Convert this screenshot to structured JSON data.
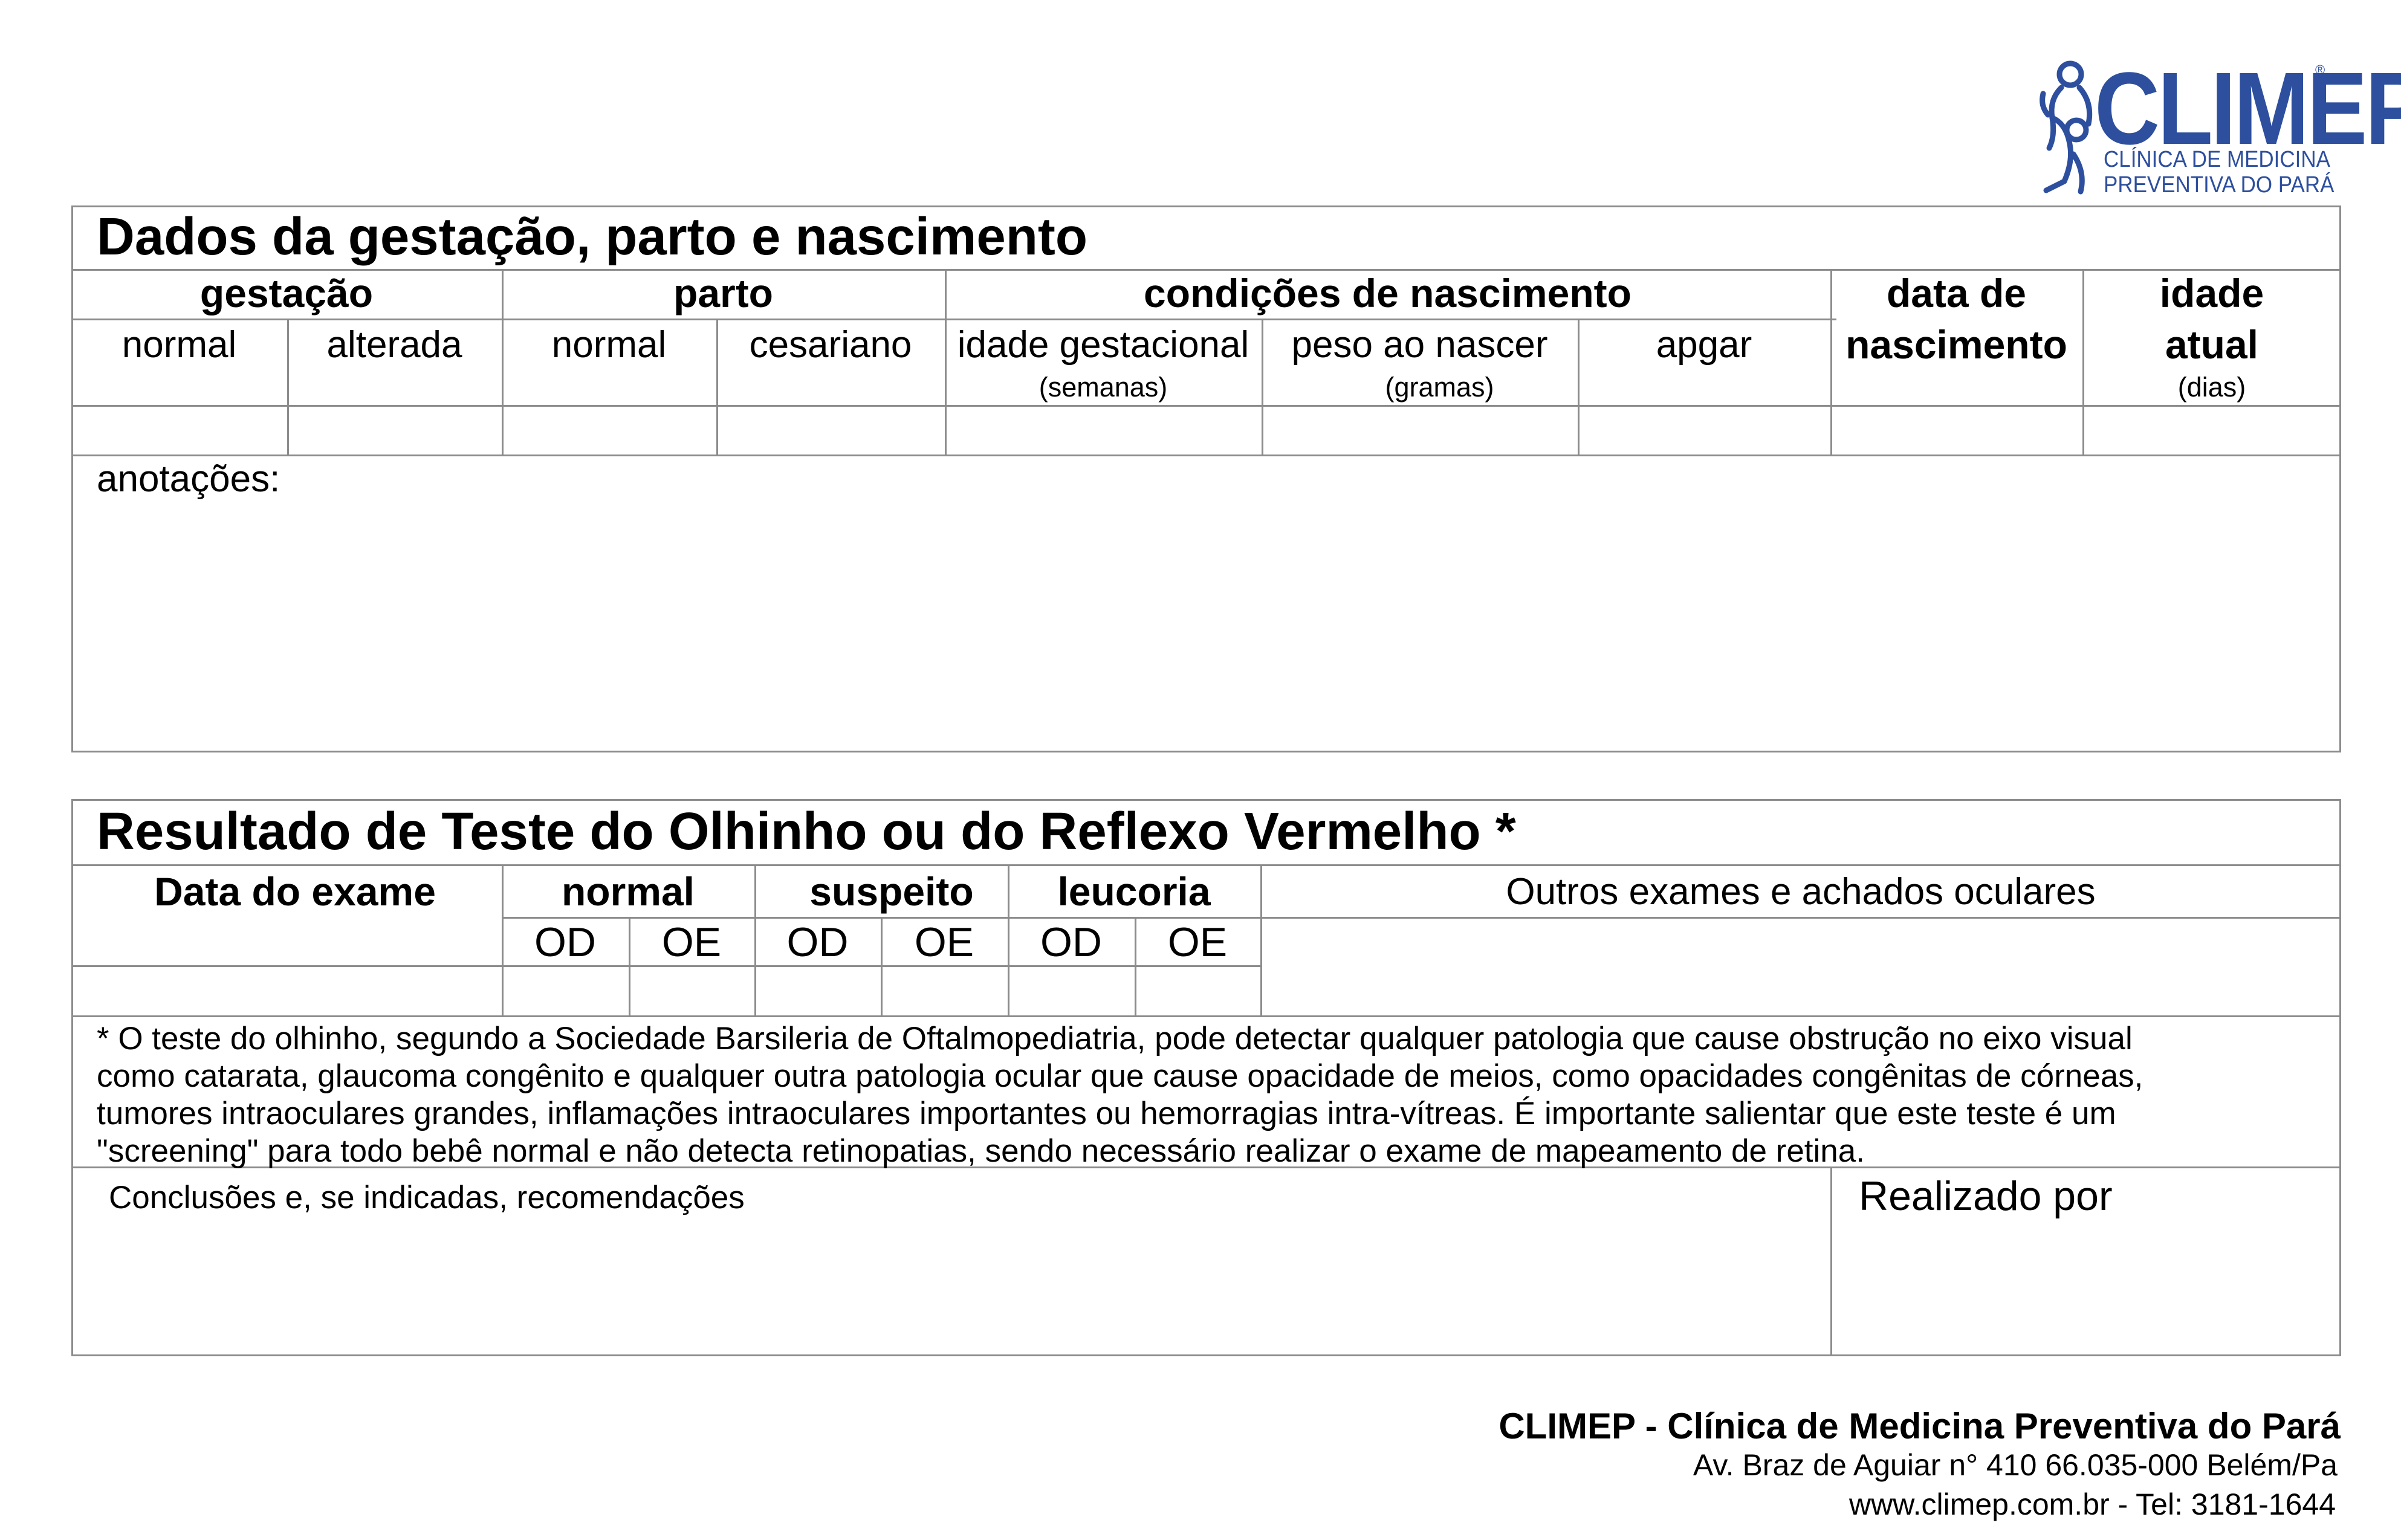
{
  "logo": {
    "brand": "CLIMEP",
    "line1": "CLÍNICA DE MEDICINA",
    "line2": "PREVENTIVA DO PARÁ",
    "color": "#2d4f9e"
  },
  "section1": {
    "title": "Dados da gestação, parto e nascimento",
    "groups": {
      "gestacao": "gestação",
      "parto": "parto",
      "condicoes": "condições de nascimento",
      "data_nasc_1": "data de",
      "data_nasc_2": "nascimento",
      "idade_1": "idade",
      "idade_2": "atual",
      "idade_unit": "(dias)"
    },
    "subs": {
      "gest_normal": "normal",
      "gest_alterada": "alterada",
      "parto_normal": "normal",
      "parto_cesariano": "cesariano",
      "idade_gestacional": "idade gestacional",
      "idade_gestacional_unit": "(semanas)",
      "peso": "peso ao nascer",
      "peso_unit": "(gramas)",
      "apgar": "apgar"
    },
    "anotacoes": "anotações:"
  },
  "section2": {
    "title": "Resultado de Teste do Olhinho ou do Reflexo Vermelho *",
    "data_exame": "Data do exame",
    "normal": "normal",
    "suspeito": "suspeito",
    "leucoria": "leucoria",
    "od": "OD",
    "oe": "OE",
    "outros": "Outros exames e achados oculares",
    "footnote": [
      "* O teste do olhinho, segundo a Sociedade Barsileria de Oftalmopediatria, pode detectar qualquer patologia que cause obstrução no eixo visual",
      "como catarata, glaucoma congênito e qualquer outra patologia ocular que cause opacidade de meios,  como opacidades congênitas de córneas,",
      "tumores intraoculares grandes, inflamações intraoculares importantes ou hemorragias intra-vítreas. É importante salientar que este teste é um",
      "\"screening\" para todo bebê  normal e não detecta retinopatias, sendo necessário realizar o exame de mapeamento de retina."
    ],
    "conclusoes": "Conclusões e, se indicadas, recomendações",
    "realizado": "Realizado por"
  },
  "footer": {
    "name": "CLIMEP - Clínica de Medicina Preventiva do Pará",
    "address": "Av. Braz de Aguiar n° 410  66.035-000  Belém/Pa",
    "contact": "www.climep.com.br   -  Tel: 3181-1644"
  }
}
